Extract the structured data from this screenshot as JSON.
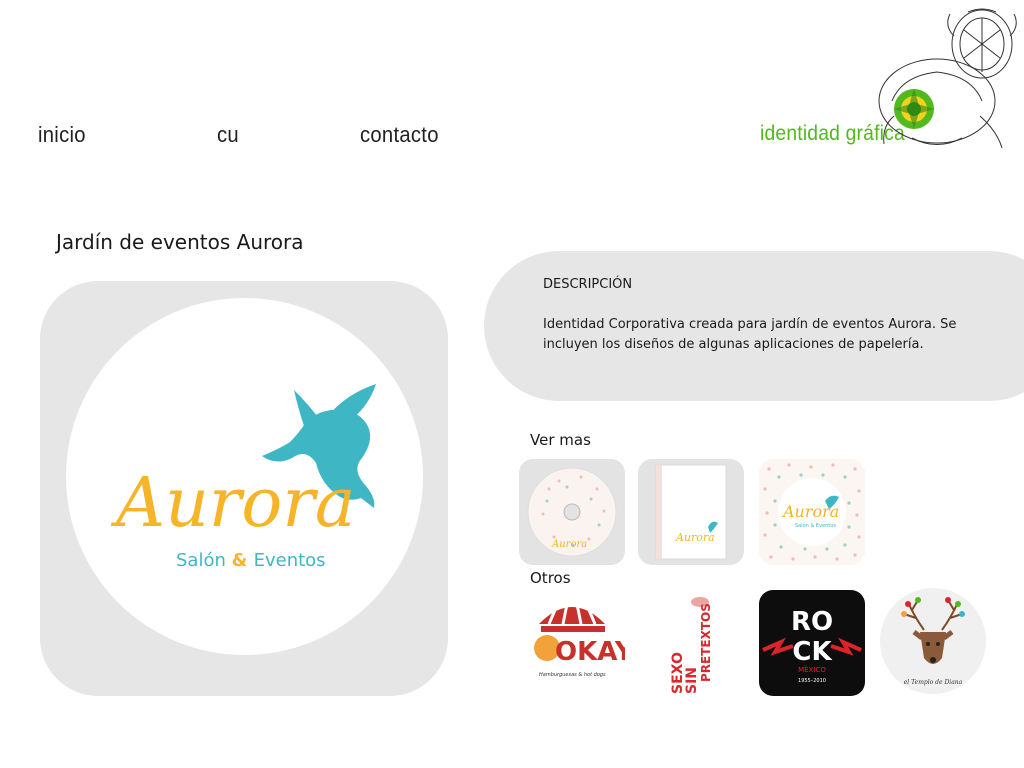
{
  "nav": {
    "inicio": "inicio",
    "cu": "cu",
    "contacto": "contacto"
  },
  "brand": {
    "label": "identidad gráfica",
    "color": "#52b91e"
  },
  "page": {
    "title": "Jardín de eventos Aurora"
  },
  "hero": {
    "logo_word": "Aurora",
    "logo_sub_left": "Salón",
    "logo_sub_amp": "&",
    "logo_sub_right": "Eventos",
    "colors": {
      "orange": "#f6b428",
      "teal": "#3fb6c4"
    }
  },
  "description": {
    "heading": "DESCRIPCIÓN",
    "text": "Identidad Corporativa creada para jardín de eventos Aurora. Se incluyen los diseños de algunas aplicaciones de papelería."
  },
  "ver_mas": {
    "label": "Ver mas",
    "items": [
      {
        "name": "cd-disc",
        "logo": "Aurora"
      },
      {
        "name": "folder",
        "logo": "Aurora"
      },
      {
        "name": "patterned-card",
        "logo": "Aurora",
        "sub": "Salón & Eventos"
      }
    ]
  },
  "otros": {
    "label": "Otros",
    "items": [
      {
        "name": "okay-logo",
        "text": "OKAY",
        "sub": "Hamburguesas & hot dogs"
      },
      {
        "name": "sexo-sin-pretextos",
        "line1": "SEXO",
        "line2": "SIN",
        "line3": "PRETEXTOS"
      },
      {
        "name": "rock-mexico",
        "line1": "RO",
        "line2": "CK",
        "line3": "MÉXICO",
        "years": "1955–2010"
      },
      {
        "name": "deer-logo",
        "caption": "el Templo de Diana"
      }
    ]
  }
}
